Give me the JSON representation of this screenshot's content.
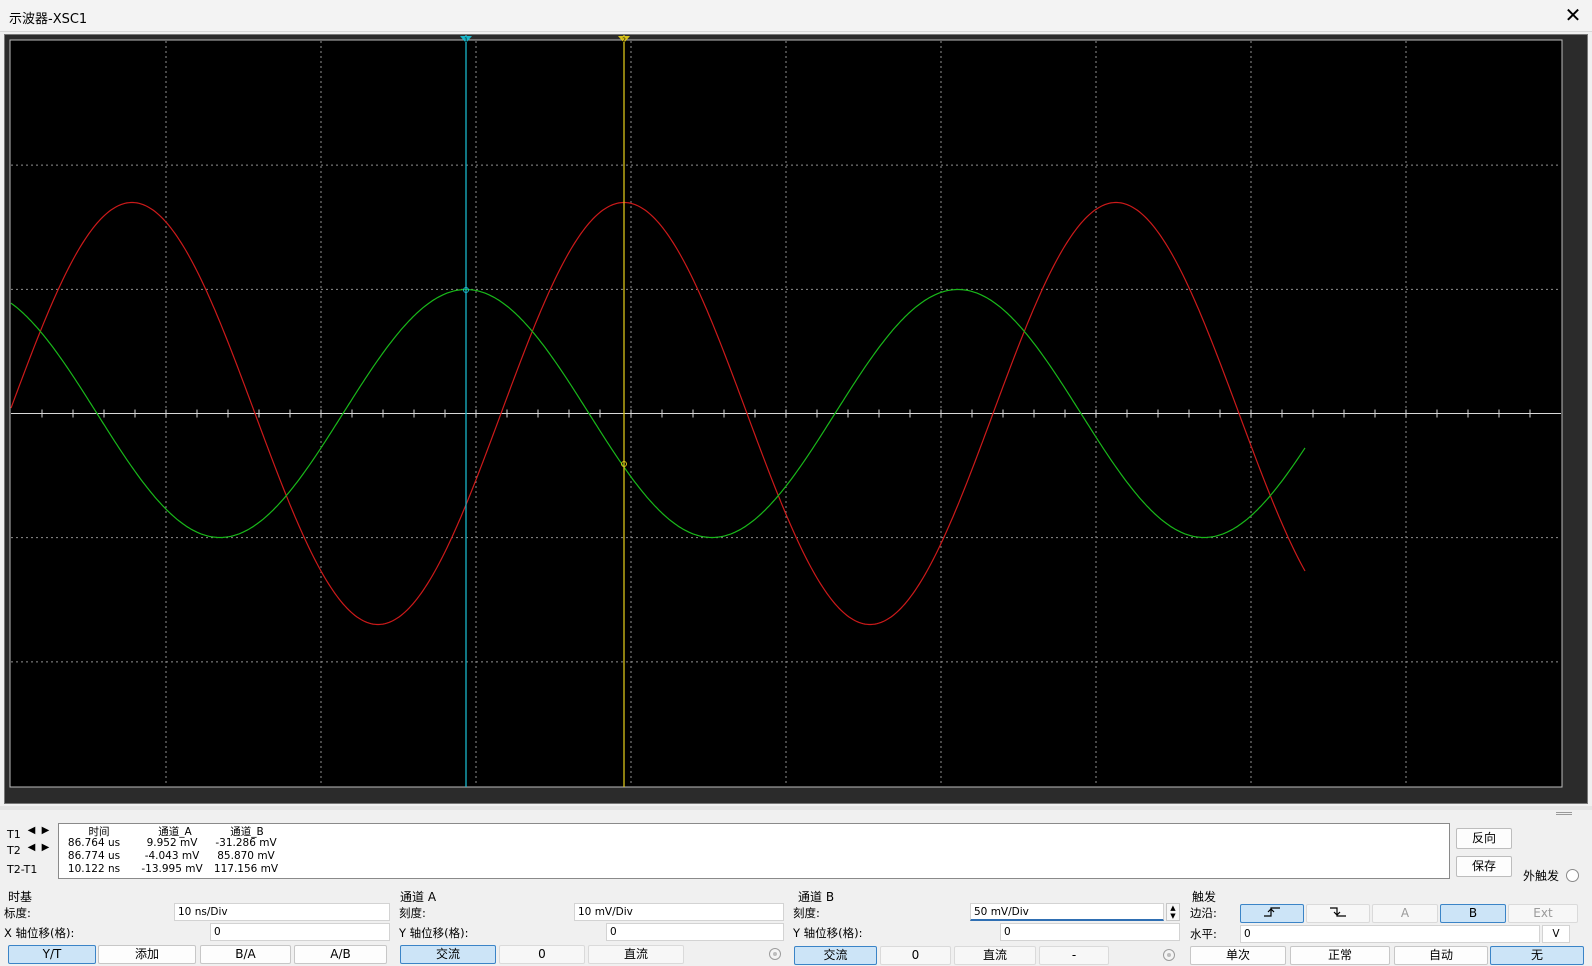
{
  "window": {
    "title": "示波器-XSC1",
    "close_glyph": "✕"
  },
  "screen": {
    "background": "#000000",
    "grid_color": "#8f8f8f",
    "channel_a_color": "#cc1a1a",
    "channel_b_color": "#19b81a",
    "cursor1_color": "#18b6c9",
    "cursor2_color": "#d8c21a",
    "horizontal_divisions": 10,
    "vertical_divisions": 6,
    "cursor_labels": {
      "t1": "1",
      "t2": "2"
    }
  },
  "readout": {
    "row_labels": [
      "T1",
      "T2",
      "T2-T1"
    ],
    "headers": [
      "时间",
      "通道_A",
      "通道_B"
    ],
    "rows": [
      [
        "86.764 us",
        "9.952 mV",
        "-31.286 mV"
      ],
      [
        "86.774 us",
        "-4.043 mV",
        "85.870 mV"
      ],
      [
        "10.122 ns",
        "-13.995 mV",
        "117.156 mV"
      ]
    ],
    "reverse_label": "反向",
    "save_label": "保存",
    "ext_trigger_label": "外触发"
  },
  "timebase": {
    "title": "时基",
    "scale_label": "标度:",
    "scale_value": "10 ns/Div",
    "offset_label": "X 轴位移(格):",
    "offset_value": "0",
    "buttons": [
      "Y/T",
      "添加",
      "B/A",
      "A/B"
    ],
    "selected": "Y/T"
  },
  "channel_a": {
    "title": "通道 A",
    "scale_label": "刻度:",
    "scale_value": "10 mV/Div",
    "offset_label": "Y 轴位移(格):",
    "offset_value": "0",
    "buttons": [
      "交流",
      "0",
      "直流"
    ],
    "selected": "交流"
  },
  "channel_b": {
    "title": "通道 B",
    "scale_label": "刻度:",
    "scale_value": "50 mV/Div",
    "offset_label": "Y 轴位移(格):",
    "offset_value": "0",
    "buttons": [
      "交流",
      "0",
      "直流",
      "-"
    ],
    "selected": "交流"
  },
  "trigger": {
    "title": "触发",
    "edge_label": "边沿:",
    "edge_buttons": [
      "rising-edge",
      "falling-edge"
    ],
    "source_buttons": [
      "A",
      "B",
      "Ext"
    ],
    "selected_edge": "rising-edge",
    "selected_source": "B",
    "level_label": "水平:",
    "level_value": "0",
    "level_unit": "V",
    "mode_buttons": [
      "单次",
      "正常",
      "自动",
      "无"
    ],
    "selected_mode": "无"
  }
}
